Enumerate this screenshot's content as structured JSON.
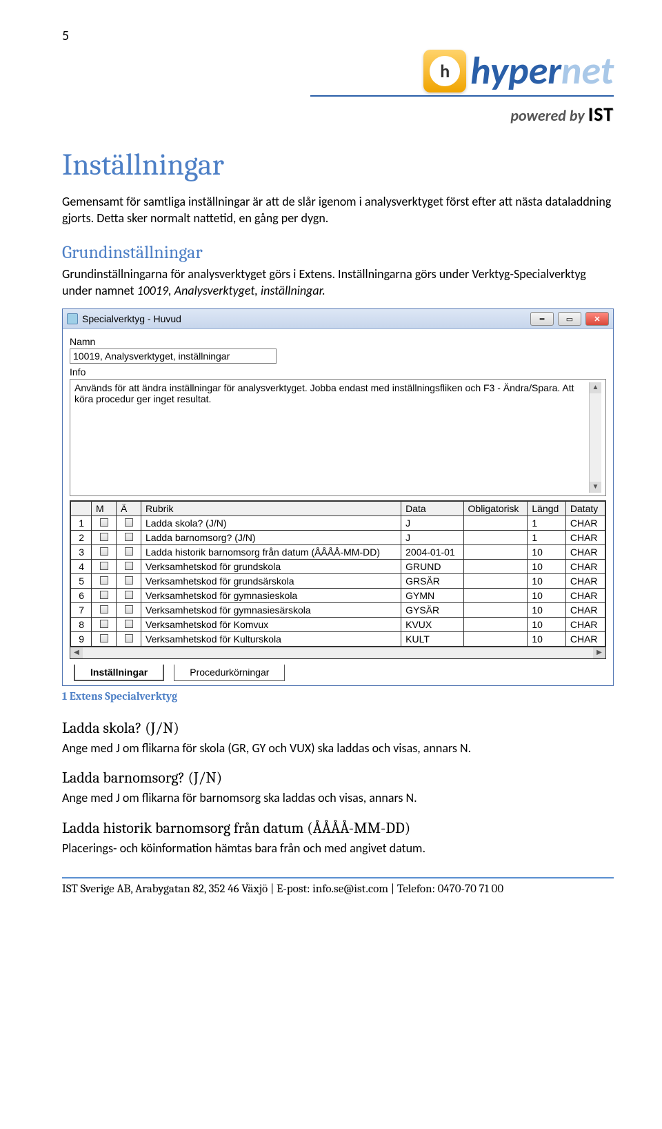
{
  "page_number": "5",
  "logo": {
    "brand_prefix": "hyper",
    "brand_suffix": "net",
    "icon_letter": "h",
    "powered_prefix": "powered by",
    "powered_brand": "IST"
  },
  "title": "Inställningar",
  "intro": "Gemensamt för samtliga inställningar är att de slår igenom i analysverktyget först efter att nästa dataladdning gjorts. Detta sker normalt nattetid, en gång per dygn.",
  "sub1_title": "Grundinställningar",
  "sub1_p1": "Grundinställningarna för analysverktyget görs i Extens. Inställningarna görs under Verktyg-Specialverktyg under namnet ",
  "sub1_p1_em": "10019, Analysverktyget, inställningar.",
  "window": {
    "title": "Specialverktyg - Huvud",
    "name_label": "Namn",
    "name_value": "10019, Analysverktyget, inställningar",
    "info_label": "Info",
    "info_text": "Används för att ändra inställningar för analysverktyget. Jobba endast med inställningsfliken och F3 - Ändra/Spara. Att köra procedur ger inget resultat.",
    "columns": [
      "",
      "M",
      "Ä",
      "Rubrik",
      "Data",
      "Obligatorisk",
      "Längd",
      "Dataty"
    ],
    "rows": [
      {
        "n": "1",
        "rubrik": "Ladda skola? (J/N)",
        "data": "J",
        "ob": "",
        "len": "1",
        "dt": "CHAR"
      },
      {
        "n": "2",
        "rubrik": "Ladda barnomsorg? (J/N)",
        "data": "J",
        "ob": "",
        "len": "1",
        "dt": "CHAR"
      },
      {
        "n": "3",
        "rubrik": "Ladda historik barnomsorg från datum (ÅÅÅÅ-MM-DD)",
        "data": "2004-01-01",
        "ob": "",
        "len": "10",
        "dt": "CHAR"
      },
      {
        "n": "4",
        "rubrik": "Verksamhetskod för grundskola",
        "data": "GRUND",
        "ob": "",
        "len": "10",
        "dt": "CHAR"
      },
      {
        "n": "5",
        "rubrik": "Verksamhetskod för grundsärskola",
        "data": "GRSÄR",
        "ob": "",
        "len": "10",
        "dt": "CHAR"
      },
      {
        "n": "6",
        "rubrik": "Verksamhetskod för gymnasieskola",
        "data": "GYMN",
        "ob": "",
        "len": "10",
        "dt": "CHAR"
      },
      {
        "n": "7",
        "rubrik": "Verksamhetskod för gymnasiesärskola",
        "data": "GYSÄR",
        "ob": "",
        "len": "10",
        "dt": "CHAR"
      },
      {
        "n": "8",
        "rubrik": "Verksamhetskod för Komvux",
        "data": "KVUX",
        "ob": "",
        "len": "10",
        "dt": "CHAR"
      },
      {
        "n": "9",
        "rubrik": "Verksamhetskod för Kulturskola",
        "data": "KULT",
        "ob": "",
        "len": "10",
        "dt": "CHAR"
      }
    ],
    "tabs": {
      "active": "Inställningar",
      "other": "Procedurkörningar"
    }
  },
  "figure_caption": "1 Extens Specialverktyg",
  "items": [
    {
      "h": "Ladda skola? (J/N)",
      "p": "Ange med J om flikarna för skola (GR, GY och VUX) ska laddas och visas, annars N."
    },
    {
      "h": "Ladda barnomsorg? (J/N)",
      "p": "Ange med J om flikarna för barnomsorg ska laddas och visas, annars N."
    },
    {
      "h": "Ladda historik barnomsorg från datum (ÅÅÅÅ-MM-DD)",
      "p": "Placerings- och köinformation hämtas bara från och med angivet datum."
    }
  ],
  "footer": "IST Sverige AB, Arabygatan 82, 352 46 Växjö   |   E-post: info.se@ist.com   |   Telefon: 0470-70 71 00"
}
